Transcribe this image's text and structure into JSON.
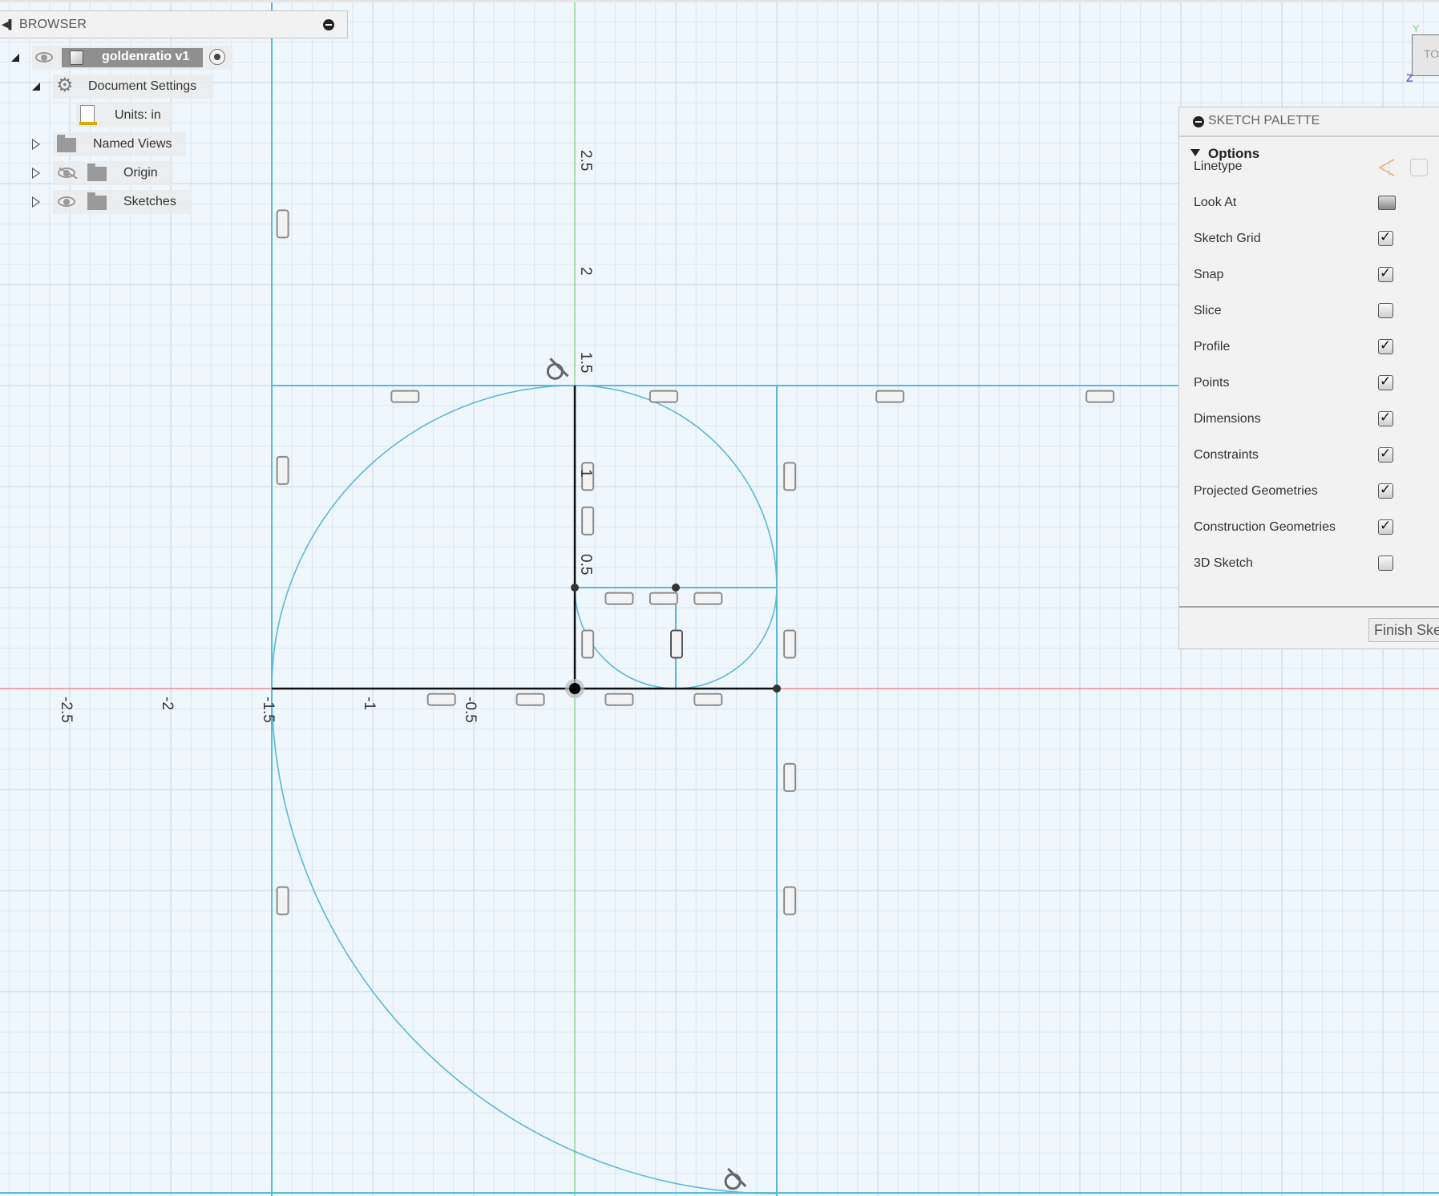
{
  "browser": {
    "title": "BROWSER",
    "component": {
      "name": "goldenratio v1"
    },
    "items": [
      {
        "label": "Document Settings",
        "expanded": true,
        "icon": "gear-icon"
      },
      {
        "label": "Units: in",
        "icon": "units-document-icon"
      },
      {
        "label": "Named Views",
        "expanded": false,
        "icon": "folder-icon"
      },
      {
        "label": "Origin",
        "expanded": false,
        "icon": "folder-icon",
        "visibility": "hidden"
      },
      {
        "label": "Sketches",
        "expanded": false,
        "icon": "folder-icon",
        "visibility": "visible"
      }
    ]
  },
  "palette": {
    "title": "SKETCH PALETTE",
    "section": "Options",
    "rows": [
      {
        "label": "Linetype",
        "type": "icons"
      },
      {
        "label": "Look At",
        "type": "icon"
      },
      {
        "label": "Sketch Grid",
        "checked": true
      },
      {
        "label": "Snap",
        "checked": true
      },
      {
        "label": "Slice",
        "checked": false
      },
      {
        "label": "Profile",
        "checked": true
      },
      {
        "label": "Points",
        "checked": true
      },
      {
        "label": "Dimensions",
        "checked": true
      },
      {
        "label": "Constraints",
        "checked": true
      },
      {
        "label": "Projected Geometries",
        "checked": true
      },
      {
        "label": "Construction Geometries",
        "checked": true
      },
      {
        "label": "3D Sketch",
        "checked": false
      }
    ],
    "finish_label": "Finish Sketch"
  },
  "viewcube": {
    "face": "TOP",
    "axis_y": "Y",
    "axis_z": "Z"
  },
  "sketch": {
    "units": "in",
    "x_tick_labels": [
      "-2.5",
      "-2",
      "-1.5",
      "-1",
      "-0.5"
    ],
    "y_tick_labels": [
      "2.5",
      "2",
      "1.5",
      "1",
      "0.5"
    ],
    "colors": {
      "construction": "#5bb8d8",
      "line": "#111111",
      "x_axis": "#e07a7a",
      "y_axis": "#7fd17f",
      "constraint": "#8a8a8a"
    }
  }
}
